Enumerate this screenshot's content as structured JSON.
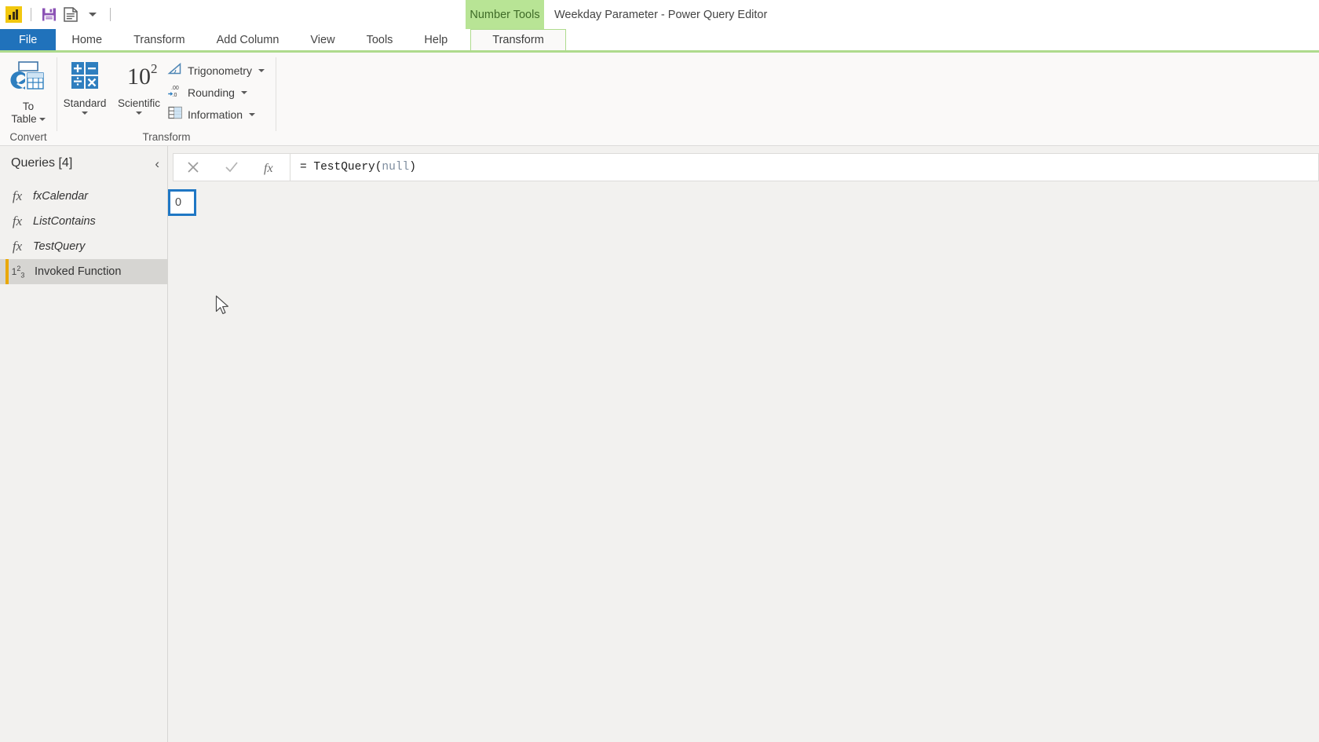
{
  "window": {
    "title": "Weekday Parameter - Power Query Editor",
    "contextual_tab_group": "Number Tools"
  },
  "quick_access": {
    "logo": "power-bi-logo",
    "items": [
      {
        "name": "save-icon",
        "label": "Save"
      },
      {
        "name": "properties-icon",
        "label": "Properties"
      },
      {
        "name": "customize-qat-chevron",
        "label": "Customize Quick Access Toolbar"
      }
    ]
  },
  "tabs": [
    {
      "id": "file",
      "label": "File",
      "active": false
    },
    {
      "id": "home",
      "label": "Home",
      "active": false
    },
    {
      "id": "transform",
      "label": "Transform",
      "active": false
    },
    {
      "id": "add-column",
      "label": "Add Column",
      "active": false
    },
    {
      "id": "view",
      "label": "View",
      "active": false
    },
    {
      "id": "tools",
      "label": "Tools",
      "active": false
    },
    {
      "id": "help",
      "label": "Help",
      "active": false
    },
    {
      "id": "number-tools-transform",
      "label": "Transform",
      "active": true
    }
  ],
  "ribbon": {
    "groups": [
      {
        "id": "convert",
        "label": "Convert",
        "buttons": [
          {
            "id": "to-table",
            "line1": "To",
            "line2": "Table",
            "has_dropdown": true
          }
        ]
      },
      {
        "id": "transform",
        "label": "Transform",
        "buttons": [
          {
            "id": "standard",
            "label": "Standard",
            "has_dropdown": true
          },
          {
            "id": "scientific",
            "label": "Scientific",
            "has_dropdown": true
          }
        ],
        "small_buttons": [
          {
            "id": "trigonometry",
            "label": "Trigonometry",
            "has_dropdown": true
          },
          {
            "id": "rounding",
            "label": "Rounding",
            "has_dropdown": true
          },
          {
            "id": "information",
            "label": "Information",
            "has_dropdown": true
          }
        ]
      }
    ]
  },
  "queries_pane": {
    "title": "Queries [4]",
    "collapse_glyph": "‹",
    "items": [
      {
        "id": "fxCalendar",
        "label": "fxCalendar",
        "icon": "fx-icon",
        "type": "function",
        "selected": false
      },
      {
        "id": "ListContains",
        "label": "ListContains",
        "icon": "fx-icon",
        "type": "function",
        "selected": false
      },
      {
        "id": "TestQuery",
        "label": "TestQuery",
        "icon": "fx-icon",
        "type": "function",
        "selected": false
      },
      {
        "id": "InvokedFunction",
        "label": "Invoked Function",
        "icon": "number-type-icon",
        "type": "number",
        "selected": true
      }
    ]
  },
  "formula_bar": {
    "cancel_glyph": "✕",
    "accept_glyph": "✓",
    "fx_glyph": "fx",
    "prefix": "=",
    "expression_head": " TestQuery(",
    "expression_token": "null",
    "expression_tail": ")",
    "full_text": "= TestQuery(null)"
  },
  "result": {
    "selected_cell_value": "0"
  },
  "colors": {
    "file_tab": "#2072bb",
    "contextual_green": "#aedb8d",
    "contextual_green_header": "#b8e495",
    "selection_blue": "#1f77c4",
    "query_accent": "#e9a800",
    "ribbon_bg": "#faf9f8",
    "pane_bg": "#f2f1ef",
    "logo_yellow": "#f2c80f"
  }
}
